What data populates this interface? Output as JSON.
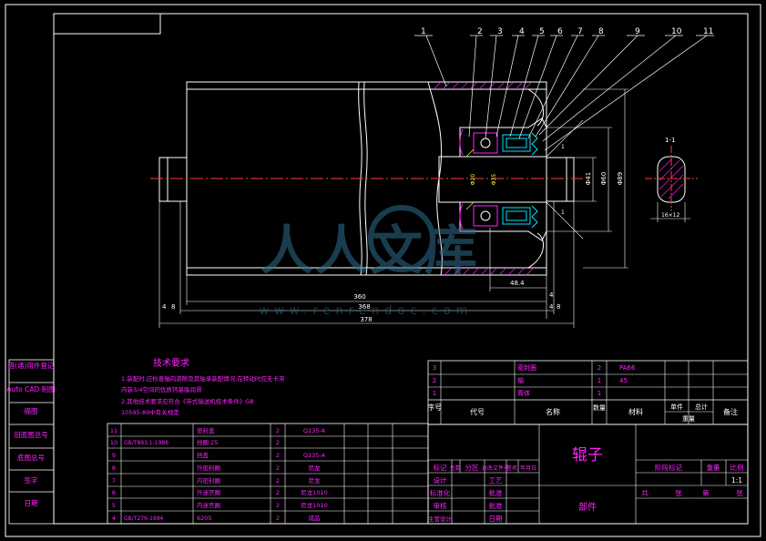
{
  "drawing": {
    "balloons": [
      "1",
      "2",
      "3",
      "4",
      "5",
      "6",
      "7",
      "8",
      "9",
      "10",
      "11"
    ],
    "dimensions": {
      "d360": "360",
      "d368": "368",
      "d378": "378",
      "d4a": "4",
      "d8a": "8",
      "d4b": "4",
      "d8b": "8",
      "d4c": "4",
      "d4d": "4",
      "phi89": "Φ89",
      "phi60": "Φ60",
      "phi41": "Φ41",
      "phi20": "Φ20",
      "phi35": "Φ35",
      "d484": "48.4",
      "section_label": "1-1",
      "section_dim": "16×12",
      "view_mark": "1"
    },
    "watermark": {
      "cn": "人人文库",
      "url": "www.renrendoc.com"
    }
  },
  "left_strip": [
    "借(通)用件登记",
    "Auto CAD 制图",
    "描图",
    "旧底图总号",
    "底图总号",
    "签字",
    "日期"
  ],
  "tech_req": {
    "title": "技术要求",
    "lines": [
      "1.装配时,应检查轴向游隙及其轴承装配情况,在转动时应无卡滞",
      "  内装3/4空间的优质钙基脂润滑",
      "2.其他技术要求应符合《带式输送机技术条件》GB",
      "  10595-89中有关规定"
    ]
  },
  "parts_upper": [
    {
      "no": "3",
      "code": "",
      "name": "密封圈",
      "qty": "2",
      "mat": "PA66",
      "remark": ""
    },
    {
      "no": "2",
      "code": "",
      "name": "轴",
      "qty": "1",
      "mat": "45",
      "remark": ""
    },
    {
      "no": "1",
      "code": "",
      "name": "筒体",
      "qty": "1",
      "mat": "",
      "remark": ""
    }
  ],
  "parts_upper_header": {
    "no": "序号",
    "code": "代号",
    "name": "名称",
    "qty": "数量",
    "mat": "材料",
    "unit": "单件",
    "total": "总计",
    "weight": "重量",
    "remark": "备注"
  },
  "parts_lower": [
    {
      "no": "11",
      "code": "",
      "name": "密封盖",
      "qty": "2",
      "mat": "Q235-A"
    },
    {
      "no": "10",
      "code": "GB/T893.1-1986",
      "name": "挡圈 25",
      "qty": "2",
      "mat": ""
    },
    {
      "no": "9",
      "code": "",
      "name": "挡盖",
      "qty": "2",
      "mat": "Q235-A"
    },
    {
      "no": "8",
      "code": "",
      "name": "外密封圈",
      "qty": "2",
      "mat": "尼龙"
    },
    {
      "no": "7",
      "code": "",
      "name": "内密封圈",
      "qty": "2",
      "mat": "尼龙"
    },
    {
      "no": "6",
      "code": "",
      "name": "外迷宫圈",
      "qty": "2",
      "mat": "尼龙1010"
    },
    {
      "no": "5",
      "code": "",
      "name": "内迷宫圈",
      "qty": "2",
      "mat": "尼龙1010"
    },
    {
      "no": "4",
      "code": "GB/T276-1994",
      "name": "6205",
      "qty": "2",
      "mat": "成品"
    }
  ],
  "title_block": {
    "rev_row": [
      "标记",
      "处数",
      "分区",
      "更改文件号",
      "签名",
      "年月日"
    ],
    "sign_left": [
      "设计",
      "标准化",
      "审核",
      "主管设计"
    ],
    "sign_mid": [
      "工艺",
      "批准",
      "批准",
      "日期"
    ],
    "drawing_name": "辊子",
    "drawing_sub": "部件",
    "stage_headers": [
      "阶段标记",
      "重量",
      "比例"
    ],
    "scale": "1:1",
    "sheet": [
      "共",
      "张",
      "第",
      "张"
    ]
  }
}
